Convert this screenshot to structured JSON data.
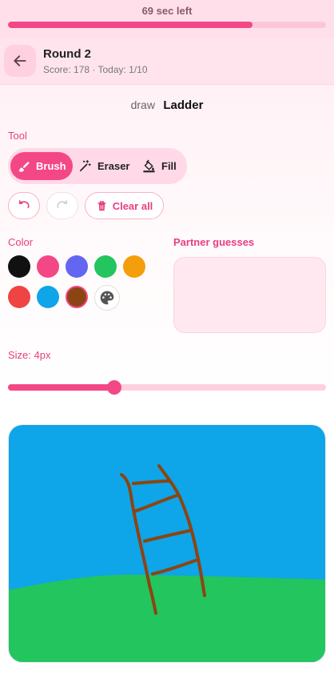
{
  "timer": {
    "text": "69 sec left",
    "progress": 0.77
  },
  "header": {
    "title": "Round 2",
    "subtitle": "Score: 178 · Today: 1/10",
    "back_icon": "arrow-left-icon"
  },
  "prompt": {
    "prefix": "draw",
    "word": "Ladder"
  },
  "tools": {
    "label": "Tool",
    "items": [
      {
        "label": "Brush",
        "icon": "brush-icon",
        "active": true
      },
      {
        "label": "Eraser",
        "icon": "magic-wand-icon",
        "active": false
      },
      {
        "label": "Fill",
        "icon": "paint-bucket-icon",
        "active": false
      }
    ]
  },
  "actions": {
    "undo_icon": "undo-icon",
    "redo_icon": "redo-icon",
    "clear_label": "Clear all",
    "clear_icon": "trash-icon"
  },
  "color": {
    "label": "Color",
    "swatches": [
      "#111111",
      "#f44786",
      "#6366f1",
      "#22c55e",
      "#f59e0b",
      "#ef4444",
      "#0ea5e9",
      "#8b4513"
    ],
    "selected": "#8b4513",
    "custom_icon": "palette-icon"
  },
  "partner": {
    "label": "Partner guesses"
  },
  "size": {
    "label": "Size: 4px",
    "fraction": 0.335
  },
  "canvas": {
    "sky": "#0ea5e9",
    "ground": "#22c55e",
    "stroke": "#8b4513"
  }
}
